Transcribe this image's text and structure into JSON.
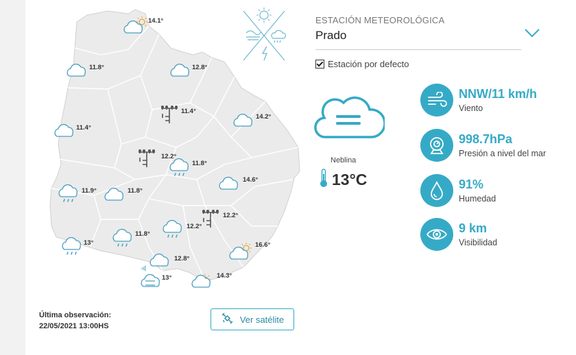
{
  "station": {
    "label": "ESTACIÓN METEOROLÓGICA",
    "selected": "Prado",
    "default_label": "Estación por defecto",
    "default_checked": true
  },
  "current": {
    "condition": "Neblina",
    "temperature": "13°C",
    "icon": "fog-cloud-icon"
  },
  "stats": [
    {
      "value": "NNW/11 km/h",
      "label": "Viento",
      "icon": "wind-icon"
    },
    {
      "value": "998.7hPa",
      "label": "Presión a nivel del mar",
      "icon": "barometer-icon"
    },
    {
      "value": "91%",
      "label": "Humedad",
      "icon": "water-drop-icon"
    },
    {
      "value": "9 km",
      "label": "Visibilidad",
      "icon": "eye-icon"
    }
  ],
  "observation": {
    "title": "Última observación:",
    "datetime": "22/05/2021 13:00HS"
  },
  "satellite_button": "Ver satélite",
  "map_readings": [
    "14.1°",
    "11.8°",
    "12.8°",
    "11.4°",
    "14.2°",
    "11.4°",
    "12.2°",
    "11.8°",
    "11.9°",
    "11.8°",
    "14.6°",
    "12.2°",
    "12.2°",
    "13°",
    "11.8°",
    "16.6°",
    "12.8°",
    "13°",
    "14.3°"
  ],
  "colors": {
    "accent": "#35aac6",
    "map_fill": "#ebebeb",
    "map_border": "#ffffff"
  }
}
